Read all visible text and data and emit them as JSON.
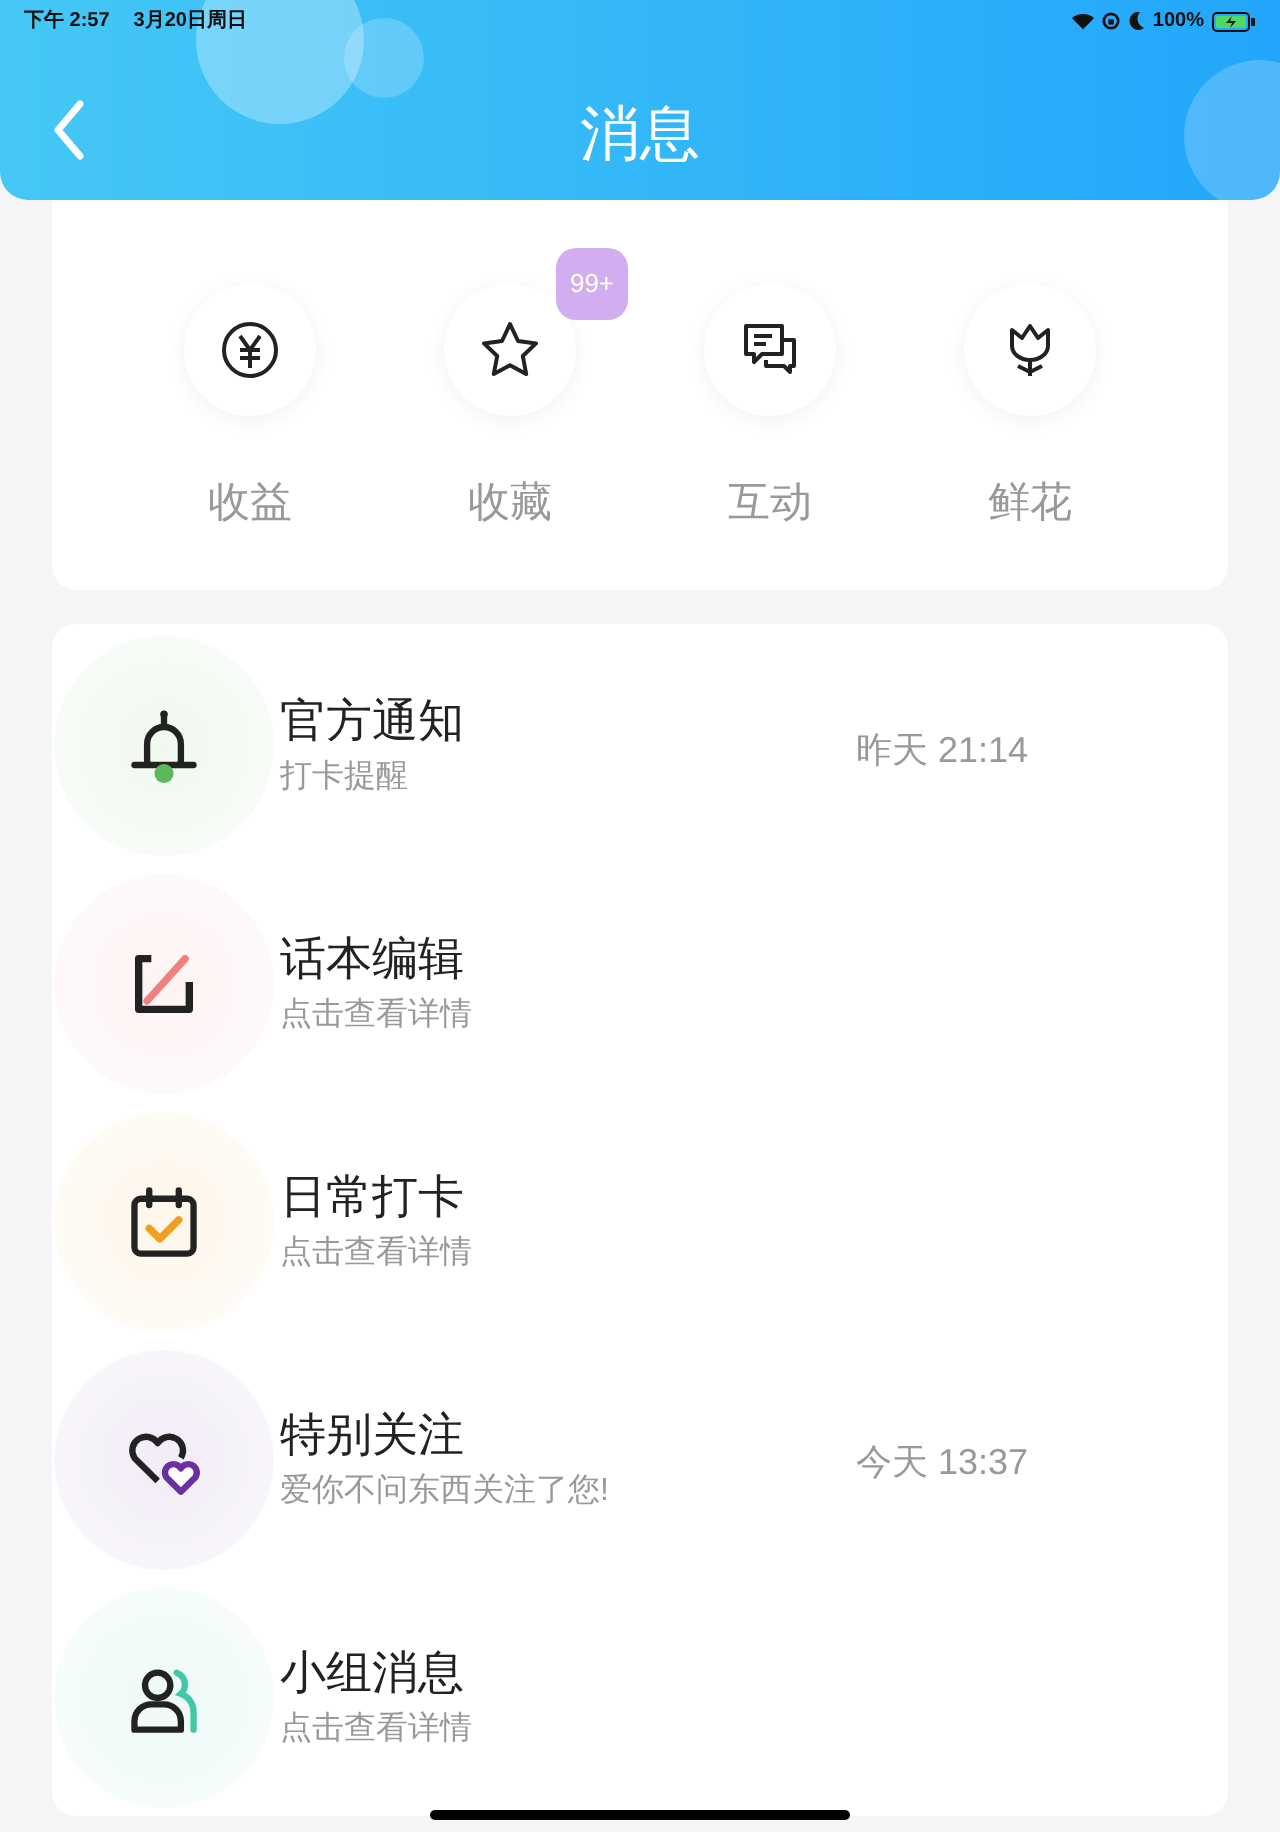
{
  "status_bar": {
    "time": "下午 2:57",
    "date": "3月20日周日",
    "battery": "100%"
  },
  "header": {
    "title": "消息"
  },
  "shortcuts": [
    {
      "kind": "income",
      "label": "收益"
    },
    {
      "kind": "favorite",
      "label": "收藏",
      "badge": "99+"
    },
    {
      "kind": "interaction",
      "label": "互动"
    },
    {
      "kind": "flower",
      "label": "鲜花"
    }
  ],
  "messages": [
    {
      "kind": "notice",
      "title": "官方通知",
      "subtitle": "打卡提醒",
      "time": "昨天 21:14"
    },
    {
      "kind": "edit",
      "title": "话本编辑",
      "subtitle": "点击查看详情"
    },
    {
      "kind": "checkin",
      "title": "日常打卡",
      "subtitle": "点击查看详情"
    },
    {
      "kind": "follow",
      "title": "特别关注",
      "subtitle": "爱你不问东西关注了您!",
      "time": "今天 13:37"
    },
    {
      "kind": "group",
      "title": "小组消息",
      "subtitle": "点击查看详情"
    }
  ]
}
